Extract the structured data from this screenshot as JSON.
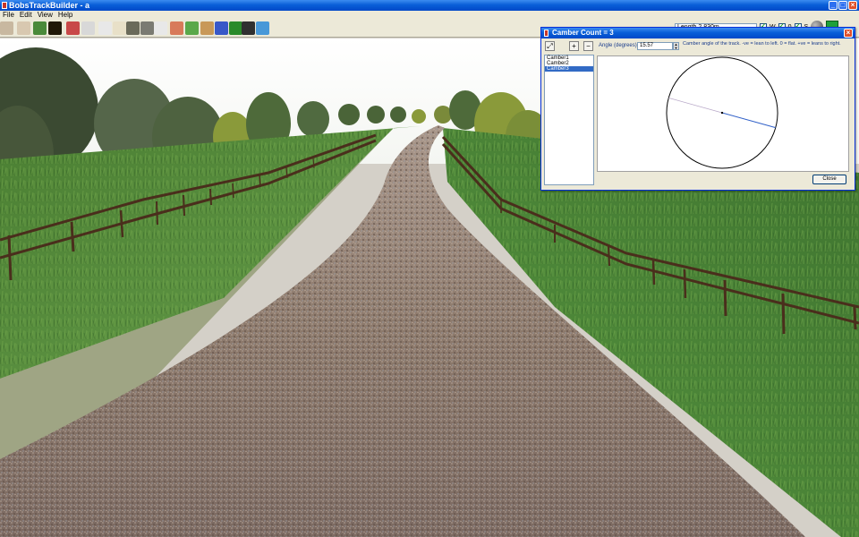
{
  "window": {
    "title": "BobsTrackBuilder - a"
  },
  "menu": [
    "File",
    "Edit",
    "View",
    "Help"
  ],
  "toolbar": {
    "tools": [
      {
        "icon": "pointer-icon",
        "color": "#c8b8a0"
      },
      {
        "icon": "node-icon",
        "color": "#d8c8b0"
      },
      {
        "icon": "tree-icon",
        "color": "#4a8a3a"
      },
      {
        "icon": "sun-icon",
        "color": "#201808"
      },
      {
        "icon": "book-icon",
        "color": "#c84848"
      },
      {
        "icon": "fence-icon",
        "color": "#d8d8d8"
      },
      {
        "icon": "spline-icon",
        "color": "#e8e8e8"
      },
      {
        "icon": "path-icon",
        "color": "#e8e0c8"
      },
      {
        "icon": "road-icon",
        "color": "#6a6a5a"
      },
      {
        "icon": "wall-icon",
        "color": "#7a7a72"
      },
      {
        "icon": "camber-icon",
        "color": "#e8e8e8"
      },
      {
        "icon": "brick-icon",
        "color": "#d87a5a"
      },
      {
        "icon": "terrain-icon",
        "color": "#5aa84a"
      },
      {
        "icon": "landscape-icon",
        "color": "#c89858"
      },
      {
        "icon": "objects-icon",
        "color": "#3858c8"
      },
      {
        "icon": "checker-icon",
        "color": "#2a8a2a"
      },
      {
        "icon": "camera-icon",
        "color": "#303030"
      },
      {
        "icon": "water-icon",
        "color": "#4898d8"
      }
    ]
  },
  "status": {
    "length": "Length 2,830m",
    "checks": [
      {
        "label": "W",
        "checked": true
      },
      {
        "label": "0",
        "checked": true
      },
      {
        "label": "S",
        "checked": true
      }
    ]
  },
  "dialog": {
    "title": "Camber Count = 3",
    "angle_label": "Angle (degrees):",
    "angle_value": "15.57",
    "hint": "Camber angle of the track. -ve = lean to left. 0 = flat. +ve = leans to right.",
    "close_label": "Close",
    "items": [
      {
        "label": "Camber1",
        "selected": false
      },
      {
        "label": "Camber2",
        "selected": false
      },
      {
        "label": "Camber3",
        "selected": true
      }
    ],
    "angle_deg": 15.57
  },
  "colors": {
    "accent": "#0a5fd8",
    "selection": "#316ac5",
    "grass": "#4f8a35",
    "road": "#8a7666",
    "fence": "#4a2e1c"
  }
}
